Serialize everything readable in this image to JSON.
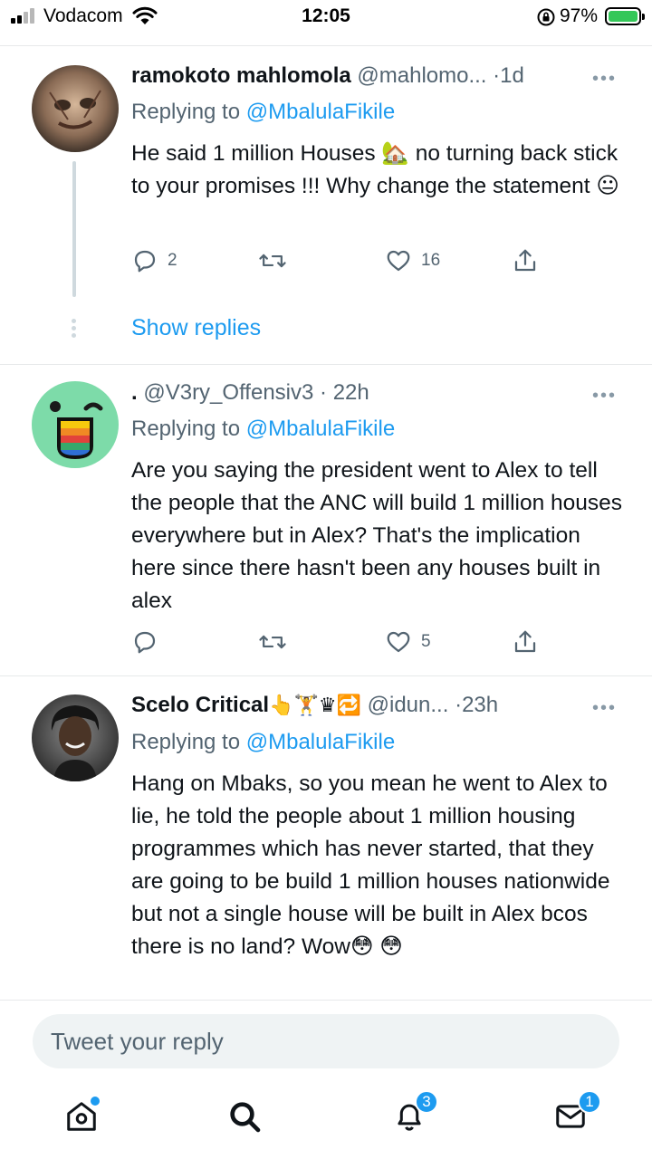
{
  "status_bar": {
    "carrier": "Vodacom",
    "time": "12:05",
    "battery": "97%"
  },
  "tweets": [
    {
      "name": "ramokoto mahlomola",
      "handle": "@mahlomo...",
      "separator": "·",
      "time": "1d",
      "replying_prefix": "Replying to",
      "replying_to": "@MbalulaFikile",
      "text": "He said 1 million Houses 🏡 no turning back stick to your promises !!! Why change the statement 😐",
      "replies": "2",
      "retweets": "",
      "likes": "16"
    },
    {
      "name": ".",
      "handle": "@V3ry_Offensiv3",
      "separator": "·",
      "time": "22h",
      "replying_prefix": "Replying to",
      "replying_to": "@MbalulaFikile",
      "text": "Are you saying the president went to Alex to tell the people that the ANC will build 1 million houses everywhere but in Alex? That's the implication here since there hasn't been any houses built in alex",
      "replies": "",
      "retweets": "",
      "likes": "5"
    },
    {
      "name": "Scelo Critical",
      "name_emoji": "👆🏋♛🔁",
      "handle": "@idun...",
      "separator": "·",
      "time": "23h",
      "replying_prefix": "Replying to",
      "replying_to": "@MbalulaFikile",
      "text": "Hang on Mbaks, so you mean he went to Alex to lie, he told the people about 1 million housing programmes which has never started, that they are going to be build 1 million houses nationwide but not a single house  will be built in Alex bcos there is no land? Wow😳 😳"
    }
  ],
  "show_replies": "Show replies",
  "more_glyph": "•••",
  "reply_box": {
    "placeholder": "Tweet your reply"
  },
  "tab_bar": {
    "notifications_badge": "3",
    "messages_badge": "1"
  },
  "colors": {
    "accent": "#1d9bf0",
    "secondary_text": "#536471",
    "divider": "#e7e9ea"
  },
  "icons": [
    "signal-icon",
    "wifi-icon",
    "orientation-lock-icon",
    "battery-icon",
    "reply-icon",
    "retweet-icon",
    "like-icon",
    "share-icon",
    "more-icon",
    "home-icon",
    "search-icon",
    "notifications-icon",
    "messages-icon"
  ]
}
